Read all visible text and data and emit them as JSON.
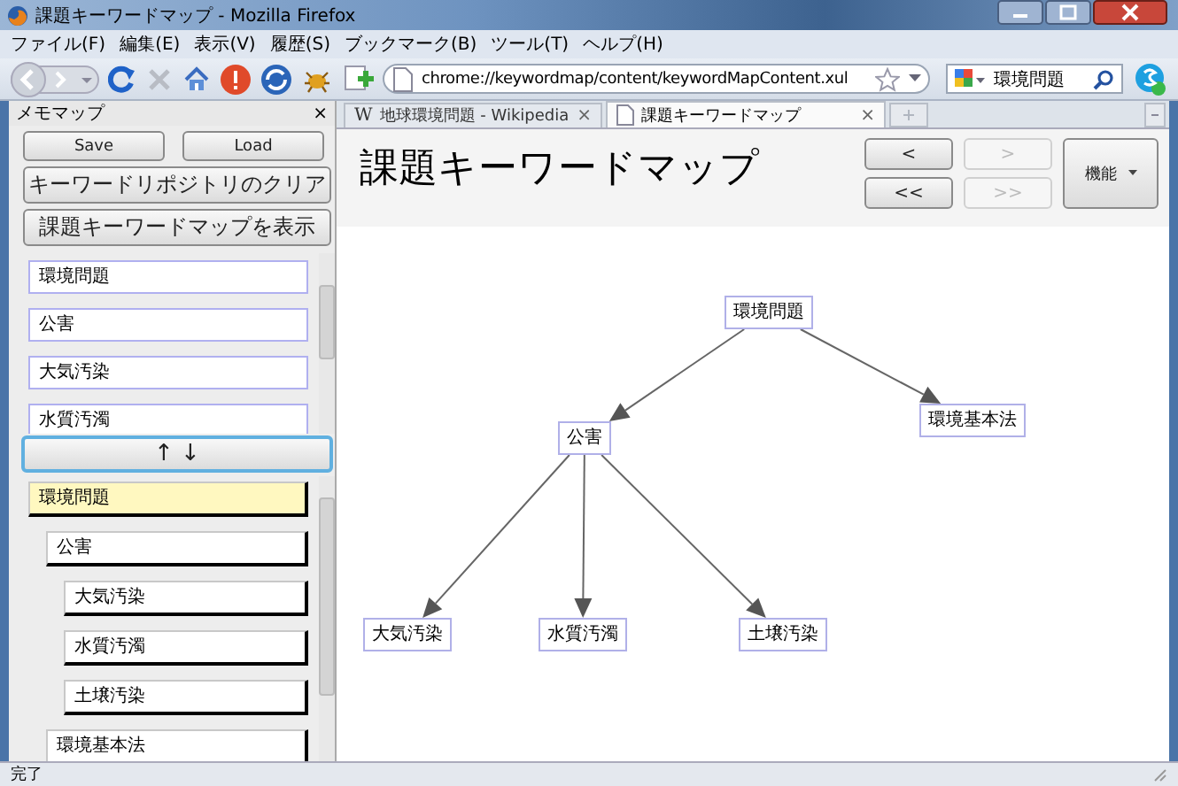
{
  "window": {
    "title": "課題キーワードマップ - Mozilla Firefox"
  },
  "menu": [
    "ファイル(F)",
    "編集(E)",
    "表示(V)",
    "履歴(S)",
    "ブックマーク(B)",
    "ツール(T)",
    "ヘルプ(H)"
  ],
  "toolbar": {
    "url": "chrome://keywordmap/content/keywordMapContent.xul",
    "search": "環境問題"
  },
  "sidebar": {
    "title": "メモマップ",
    "close": "×",
    "buttons": [
      "Save",
      "Load"
    ],
    "clear_button": "キーワードリポジトリのクリア",
    "show_button": "課題キーワードマップを表示",
    "keywords": [
      "環境問題",
      "公害",
      "大気汚染",
      "水質汚濁"
    ],
    "move_button": "↑ ↓",
    "tree": [
      {
        "label": "環境問題",
        "selected": true,
        "children": [
          {
            "label": "公害",
            "selected": false,
            "children": [
              {
                "label": "大気汚染",
                "selected": false
              },
              {
                "label": "水質汚濁",
                "selected": false
              },
              {
                "label": "土壌汚染",
                "selected": false
              }
            ]
          },
          {
            "label": "環境基本法",
            "selected": false
          }
        ]
      }
    ]
  },
  "tabs": [
    {
      "favicon": "W",
      "label": "地球環境問題 - Wikipedia",
      "close": "×",
      "selected": false
    },
    {
      "label": "課題キーワードマップ",
      "close": "×",
      "selected": true
    }
  ],
  "map": {
    "title": "課題キーワードマップ",
    "nav_buttons": [
      {
        "label": "<",
        "disabled": false
      },
      {
        "label": ">",
        "disabled": true
      },
      {
        "label": "<<",
        "disabled": false
      },
      {
        "label": ">>",
        "disabled": true
      }
    ],
    "menu_button": "機能",
    "nodes": [
      {
        "label": "環境問題",
        "children": [
          {
            "label": "公害",
            "children": [
              {
                "label": "大気汚染"
              },
              {
                "label": "水質汚濁"
              },
              {
                "label": "土壌汚染"
              }
            ]
          },
          {
            "label": "環境基本法"
          }
        ]
      }
    ]
  },
  "status_bar": "完了"
}
